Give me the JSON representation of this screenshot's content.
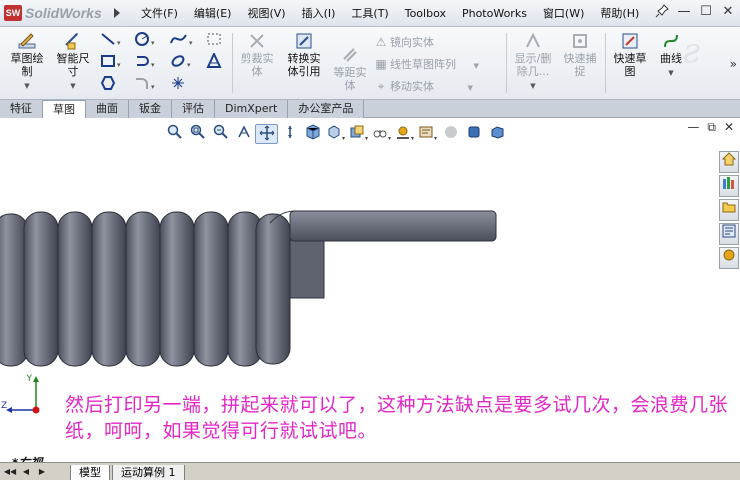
{
  "app": {
    "name": "SolidWorks",
    "logo_mark": "SW"
  },
  "menu": [
    "文件(F)",
    "编辑(E)",
    "视图(V)",
    "插入(I)",
    "工具(T)",
    "Toolbox",
    "PhotoWorks",
    "窗口(W)",
    "帮助(H)"
  ],
  "window_controls": {
    "pin": "pin-icon",
    "minimize": "—",
    "restore": "☐",
    "close": "✕"
  },
  "commands": {
    "sketch": "草图绘\n制",
    "smart_dim": "智能尺\n寸",
    "trim": "剪裁实\n体",
    "convert": "转换实\n体引用",
    "offset": "等距实\n体",
    "mirror": "镜向实体",
    "linear_pattern": "线性草图阵列",
    "move": "移动实体",
    "show_hide": "显示/删\n除几...",
    "quick_snap": "快速捕\n捉",
    "rapid_sketch": "快速草\n图",
    "spline": "曲线"
  },
  "tabs": [
    "特征",
    "草图",
    "曲面",
    "钣金",
    "评估",
    "DimXpert",
    "办公室产品"
  ],
  "active_tab": "草图",
  "heads_up_icons": [
    "zoom-to-fit-icon",
    "zoom-area-icon",
    "previous-view-icon",
    "section-view-icon",
    "pan-icon",
    "rotate-icon",
    "view-orientation-icon",
    "display-style-icon",
    "hide-show-icon",
    "edit-appearance-icon",
    "apply-scene-icon",
    "view-settings-icon",
    "sphere-icon",
    "cube-icon",
    "cube-outline-icon"
  ],
  "taskpane_icons": [
    "home-icon",
    "library-icon",
    "folder-icon",
    "view-palette-icon",
    "appearance-icon"
  ],
  "caption": "然后打印另一端，拼起来就可以了，这种方法缺点是要多试几次，会浪费几张纸，呵呵，如果觉得可行就试试吧。",
  "view_name": "*右视",
  "bottom_tabs": [
    "模型",
    "运动算例 1"
  ],
  "colors": {
    "caption": "#e327c6",
    "spring": "#6e7280",
    "triad_x": "#d21414",
    "triad_y": "#1f8a22",
    "triad_z": "#2233a8"
  }
}
